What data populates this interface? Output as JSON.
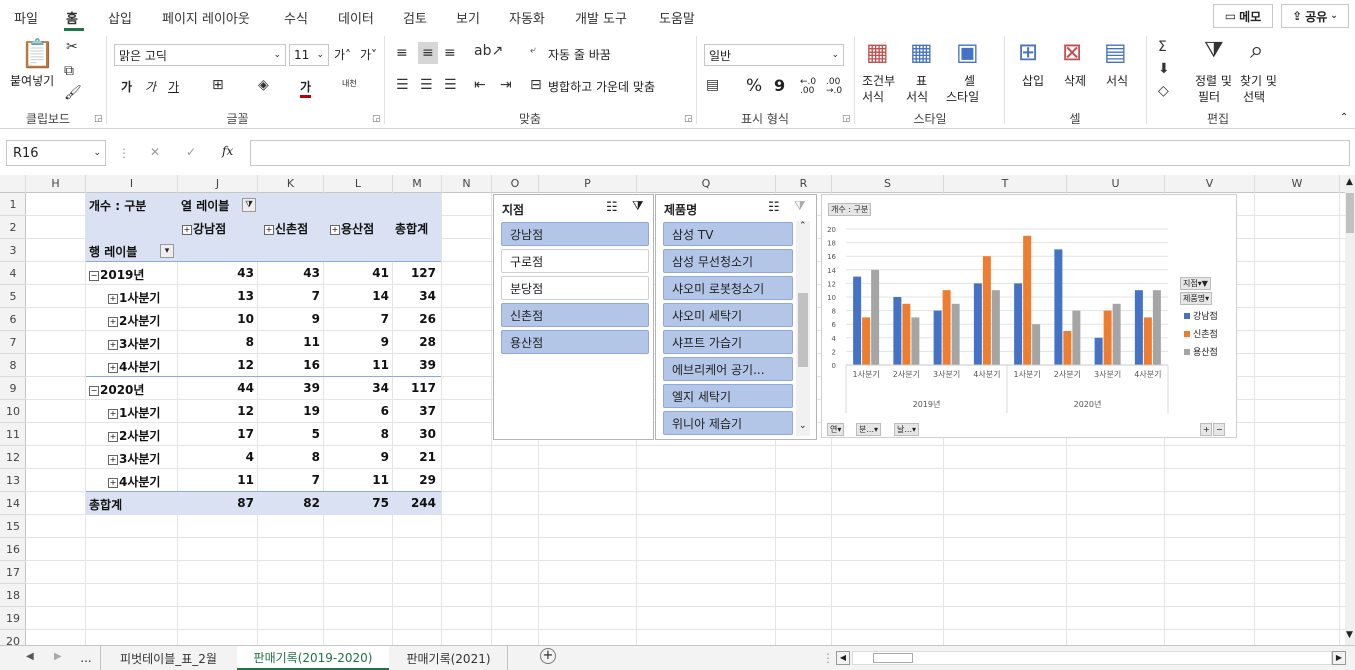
{
  "menu": {
    "tabs": [
      "파일",
      "홈",
      "삽입",
      "페이지 레이아웃",
      "수식",
      "데이터",
      "검토",
      "보기",
      "자동화",
      "개발 도구",
      "도움말"
    ],
    "memo_label": "메모",
    "share_label": "공유"
  },
  "ribbon": {
    "clipboard": {
      "paste": "붙여넣기",
      "label": "클립보드"
    },
    "font": {
      "name": "맑은 고딕",
      "size": "11",
      "label": "글꼴",
      "bold": "가",
      "italic": "가",
      "underline": "가",
      "grow": "가˄",
      "shrink": "가˅",
      "phonetic": "내천"
    },
    "align": {
      "wrap": "자동 줄 바꿈",
      "merge": "병합하고 가운데 맞춤",
      "label": "맞춤"
    },
    "number": {
      "format": "일반",
      "label": "표시 형식",
      "percent": "%",
      "comma": "9",
      "inc": "←.0 .00",
      "dec": ".00 →.0"
    },
    "style": {
      "cond": "조건부",
      "cond2": "서식",
      "table": "표",
      "table2": "서식",
      "cell": "셀",
      "cell2": "스타일",
      "label": "스타일"
    },
    "cells": {
      "insert": "삽입",
      "delete": "삭제",
      "format": "서식",
      "label": "셀"
    },
    "edit": {
      "sort": "정렬 및",
      "sort2": "필터",
      "find": "찾기 및",
      "find2": "선택",
      "label": "편집"
    }
  },
  "formula": {
    "cell_ref": "R16",
    "value": ""
  },
  "columns": [
    "H",
    "I",
    "J",
    "K",
    "L",
    "M",
    "N",
    "O",
    "P",
    "Q",
    "R",
    "S",
    "T",
    "U",
    "V",
    "W"
  ],
  "rows": [
    "1",
    "2",
    "3",
    "4",
    "5",
    "6",
    "7",
    "8",
    "9",
    "10",
    "11",
    "12",
    "13",
    "14",
    "15",
    "16",
    "17",
    "18",
    "19",
    "20"
  ],
  "pivot": {
    "count_label": "개수 : 구분",
    "col_label": "열 레이블",
    "row_label": "행 레이블",
    "headers": [
      "강남점",
      "신촌점",
      "용산점",
      "총합계"
    ],
    "rows": [
      {
        "label": "2019년",
        "level": 0,
        "values": [
          "43",
          "43",
          "41",
          "127"
        ]
      },
      {
        "label": "1사분기",
        "level": 1,
        "values": [
          "13",
          "7",
          "14",
          "34"
        ]
      },
      {
        "label": "2사분기",
        "level": 1,
        "values": [
          "10",
          "9",
          "7",
          "26"
        ]
      },
      {
        "label": "3사분기",
        "level": 1,
        "values": [
          "8",
          "11",
          "9",
          "28"
        ]
      },
      {
        "label": "4사분기",
        "level": 1,
        "values": [
          "12",
          "16",
          "11",
          "39"
        ]
      },
      {
        "label": "2020년",
        "level": 0,
        "values": [
          "44",
          "39",
          "34",
          "117"
        ]
      },
      {
        "label": "1사분기",
        "level": 1,
        "values": [
          "12",
          "19",
          "6",
          "37"
        ]
      },
      {
        "label": "2사분기",
        "level": 1,
        "values": [
          "17",
          "5",
          "8",
          "30"
        ]
      },
      {
        "label": "3사분기",
        "level": 1,
        "values": [
          "4",
          "8",
          "9",
          "21"
        ]
      },
      {
        "label": "4사분기",
        "level": 1,
        "values": [
          "11",
          "7",
          "11",
          "29"
        ]
      }
    ],
    "total_label": "총합계",
    "totals": [
      "87",
      "82",
      "75",
      "244"
    ]
  },
  "slicer_branch": {
    "title": "지점",
    "items": [
      {
        "label": "강남점",
        "selected": true
      },
      {
        "label": "구로점",
        "selected": false
      },
      {
        "label": "분당점",
        "selected": false
      },
      {
        "label": "신촌점",
        "selected": true
      },
      {
        "label": "용산점",
        "selected": true
      }
    ]
  },
  "slicer_product": {
    "title": "제품명",
    "items": [
      {
        "label": "삼성 TV",
        "selected": true
      },
      {
        "label": "삼성 무선청소기",
        "selected": true
      },
      {
        "label": "샤오미 로봇청소기",
        "selected": true
      },
      {
        "label": "샤오미 세탁기",
        "selected": true
      },
      {
        "label": "샤프트 가습기",
        "selected": true
      },
      {
        "label": "에브리케어 공기...",
        "selected": true
      },
      {
        "label": "엘지 세탁기",
        "selected": true
      },
      {
        "label": "위니아 제습기",
        "selected": true
      }
    ]
  },
  "chart_data": {
    "type": "bar",
    "value_button": "개수 : 구분",
    "categories": [
      "1사분기",
      "2사분기",
      "3사분기",
      "4사분기",
      "1사분기",
      "2사분기",
      "3사분기",
      "4사분기"
    ],
    "groups": [
      {
        "label": "2019년",
        "span": 4
      },
      {
        "label": "2020년",
        "span": 4
      }
    ],
    "series": [
      {
        "name": "강남점",
        "color": "#4472c4",
        "values": [
          13,
          10,
          8,
          12,
          12,
          17,
          4,
          11
        ]
      },
      {
        "name": "신촌점",
        "color": "#ed7d31",
        "values": [
          7,
          9,
          11,
          16,
          19,
          5,
          8,
          7
        ]
      },
      {
        "name": "용산점",
        "color": "#a5a5a5",
        "values": [
          14,
          7,
          9,
          11,
          6,
          8,
          9,
          11
        ]
      }
    ],
    "ylim": [
      0,
      20
    ],
    "yticks": [
      "0",
      "2",
      "4",
      "6",
      "8",
      "10",
      "12",
      "14",
      "16",
      "18",
      "20"
    ],
    "legend_fields": [
      "지점",
      "제품명"
    ],
    "axis_buttons": [
      "연",
      "분...",
      "날..."
    ]
  },
  "sheets": {
    "tabs": [
      "...",
      "피벗테이블_표_2월",
      "판매기록(2019-2020)",
      "판매기록(2021)"
    ],
    "active": 2
  }
}
